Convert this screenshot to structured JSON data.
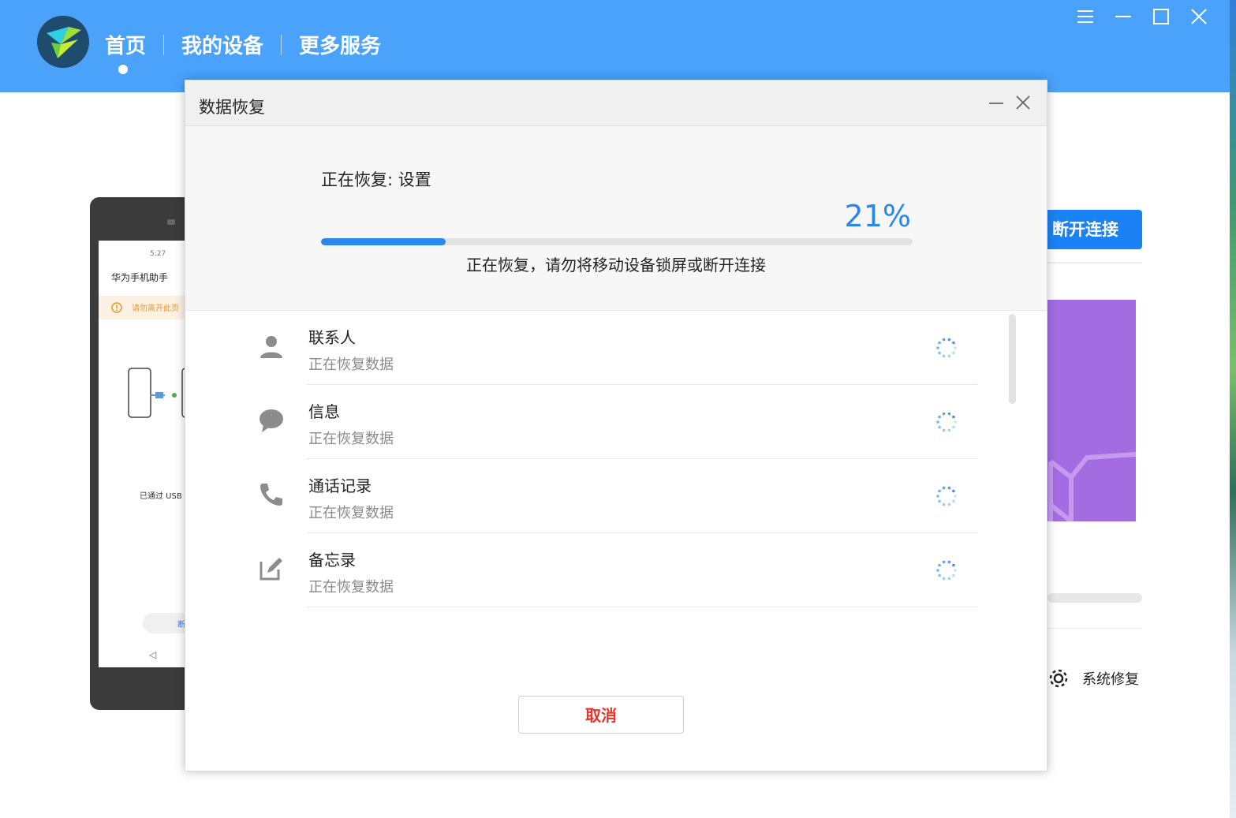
{
  "app": {
    "nav": {
      "home": "首页",
      "devices": "我的设备",
      "services": "更多服务"
    }
  },
  "background": {
    "device_screen": {
      "status": "5:27",
      "title": "华为手机助手",
      "warning": "请勿离开此页",
      "usb_text": "已通过 USB",
      "pill_text": "断"
    },
    "disconnect_button": "断开连接",
    "repair_label": "系统修复"
  },
  "dialog": {
    "title": "数据恢复",
    "restoring_label": "正在恢复: 设置",
    "percent_text": "21%",
    "progress_fraction": 0.21,
    "hint": "正在恢复，请勿将移动设备锁屏或断开连接",
    "items": [
      {
        "title": "联系人",
        "status": "正在恢复数据",
        "icon": "person-icon"
      },
      {
        "title": "信息",
        "status": "正在恢复数据",
        "icon": "message-icon"
      },
      {
        "title": "通话记录",
        "status": "正在恢复数据",
        "icon": "phone-icon"
      },
      {
        "title": "备忘录",
        "status": "正在恢复数据",
        "icon": "note-edit-icon"
      }
    ],
    "cancel_label": "取消"
  },
  "colors": {
    "topbar": "#4aa2fb",
    "accent": "#2a87ee",
    "cancel_text": "#e8332a",
    "promo": "#a36ce0"
  }
}
